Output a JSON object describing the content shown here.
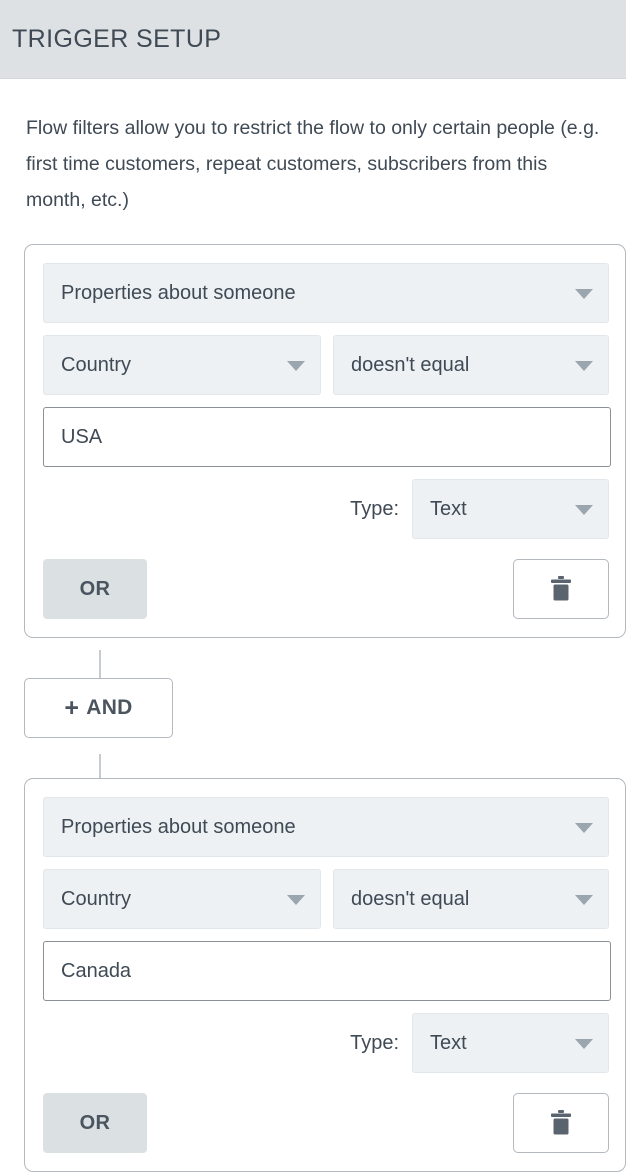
{
  "header": {
    "title": "TRIGGER SETUP"
  },
  "description": "Flow filters allow you to restrict the flow to only certain people (e.g. first time customers, repeat customers, subscribers from this month, etc.)",
  "colors": {
    "header_background": "#dde1e4",
    "select_background": "#eef1f4",
    "card_border": "#b3b9be",
    "or_button_background": "#dbe0e3",
    "text": "#3f4a55",
    "caret": "#9aa5ad"
  },
  "labels": {
    "type_label": "Type:",
    "or_button": "OR",
    "and_button": "AND",
    "and_plus": "+",
    "delete_icon": "trash-icon",
    "caret_icon": "chevron-down-icon"
  },
  "filter_groups": [
    {
      "source_select": "Properties about someone",
      "property_select": "Country",
      "operator_select": "doesn't equal",
      "value_input": "USA",
      "value_placeholder": "",
      "type_select": "Text"
    },
    {
      "source_select": "Properties about someone",
      "property_select": "Country",
      "operator_select": "doesn't equal",
      "value_input": "Canada",
      "value_placeholder": "",
      "type_select": "Text"
    }
  ]
}
